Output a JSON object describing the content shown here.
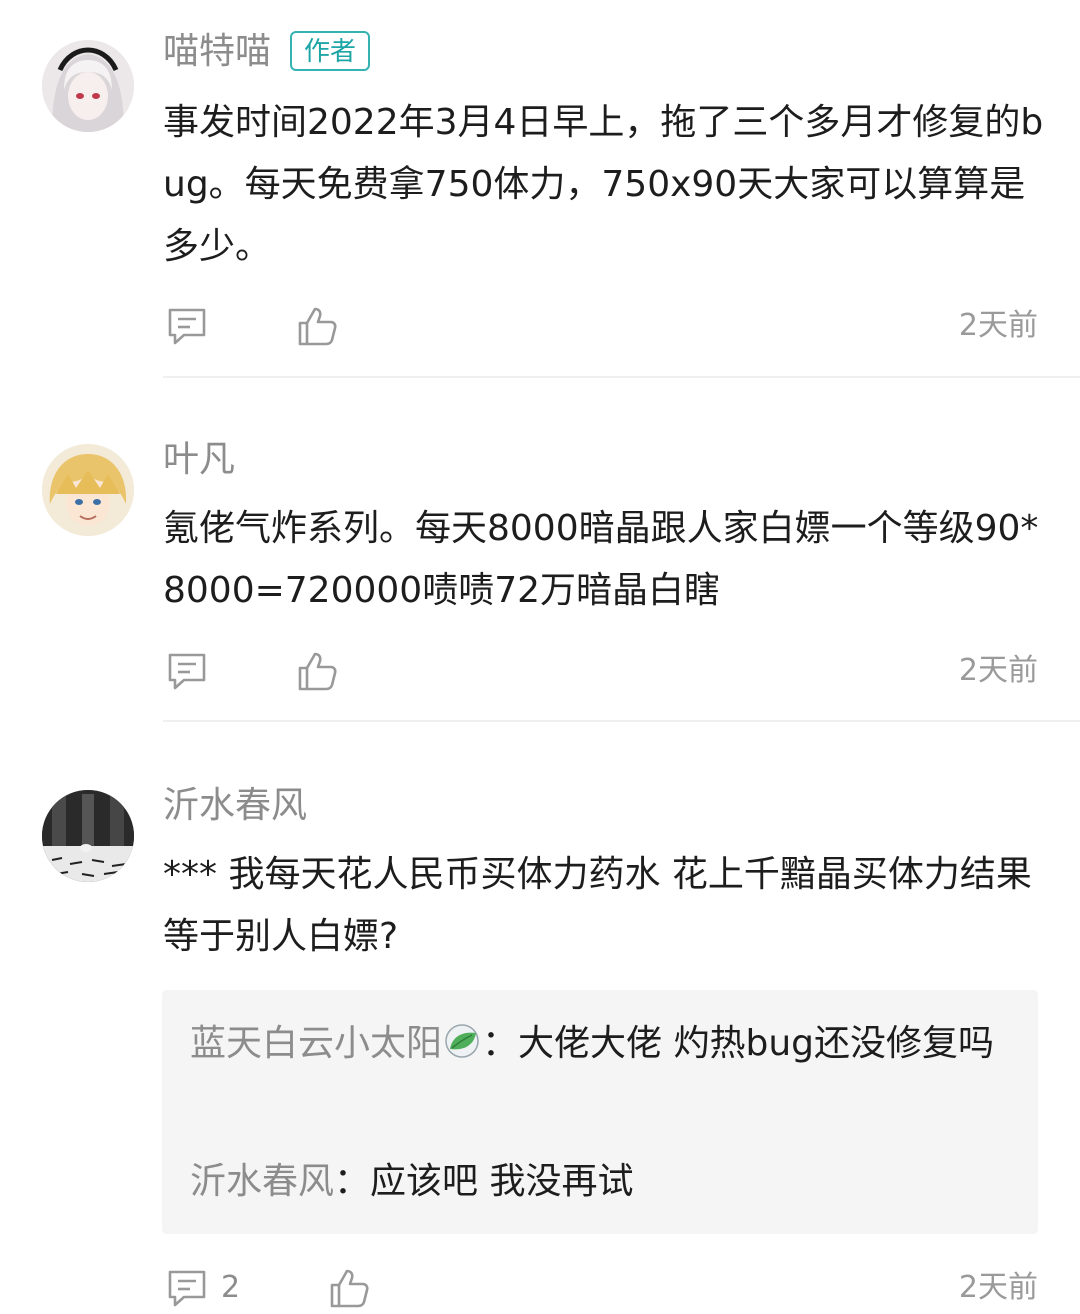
{
  "comments": [
    {
      "username": "喵特喵",
      "badge": "作者",
      "text": "事发时间2022年3月4日早上，拖了三个多月才修复的bug。每天免费拿750体力，750x90天大家可以算算是多少。",
      "time": "2天前",
      "reply_count": ""
    },
    {
      "username": "叶凡",
      "text": "氪佬气炸系列。每天8000暗晶跟人家白嫖一个等级90*8000=720000啧啧72万暗晶白瞎",
      "time": "2天前",
      "reply_count": ""
    },
    {
      "username": "沂水春风",
      "text": "*** 我每天花人民币买体力药水 花上千黯晶买体力结果等于别人白嫖?",
      "time": "2天前",
      "reply_count": "2",
      "replies": [
        {
          "user": "蓝天白云小太阳",
          "sep": "：",
          "text": "大佬大佬  灼热bug还没修复吗"
        },
        {
          "user": "沂水春风",
          "sep": "：",
          "text": "应该吧 我没再试"
        }
      ]
    }
  ],
  "icons": {
    "reply": "comment-bubble-icon",
    "like": "thumbs-up-icon",
    "badge_emoji": "leaf-icon"
  },
  "colors": {
    "badge": "#1ea6a6",
    "username": "#8c8c8c",
    "text": "#1d1d1d",
    "reply_bg": "#f5f5f5"
  }
}
